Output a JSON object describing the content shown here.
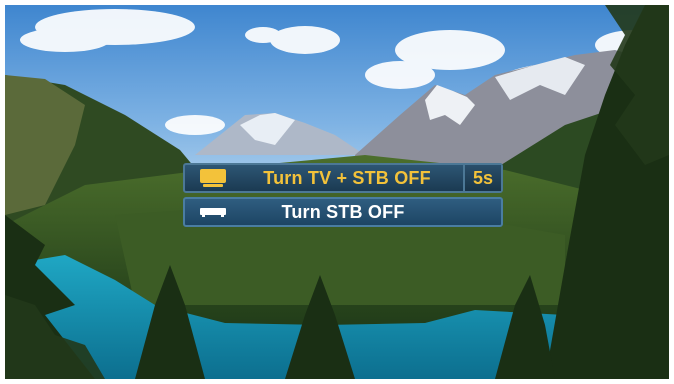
{
  "menu": {
    "options": [
      {
        "label": "Turn TV + STB OFF",
        "icon": "tv-icon",
        "countdown": "5s",
        "selected": true,
        "color": "#f3c23a"
      },
      {
        "label": "Turn STB OFF",
        "icon": "set-top-box-icon",
        "selected": false,
        "color": "#ffffff"
      }
    ]
  }
}
